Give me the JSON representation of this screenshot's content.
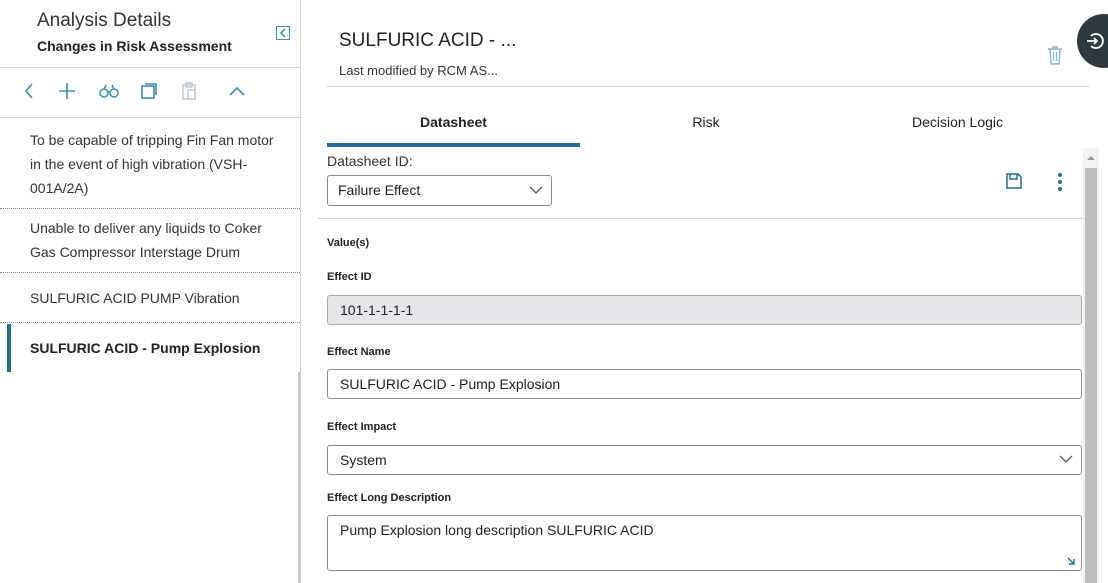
{
  "left_panel": {
    "title": "Analysis Details",
    "subtitle": "Changes in Risk Assessment",
    "toolbar_icons": [
      "back-icon",
      "add-icon",
      "binoculars-icon",
      "copy-icon",
      "paste-icon",
      "chevron-up-icon"
    ],
    "items": [
      {
        "label": "To be capable of tripping Fin Fan motor in the event of high vibration (VSH-001A/2A)",
        "selected": false
      },
      {
        "label": "Unable to deliver any liquids to Coker Gas Compressor Interstage Drum",
        "selected": false
      },
      {
        "label": "SULFURIC ACID PUMP Vibration",
        "selected": false
      },
      {
        "label": "SULFURIC ACID - Pump Explosion",
        "selected": true
      }
    ]
  },
  "header": {
    "title": "SULFURIC ACID - ...",
    "subtitle": "Last modified by RCM AS..."
  },
  "tabs": [
    {
      "label": "Datasheet",
      "active": true
    },
    {
      "label": "Risk",
      "active": false
    },
    {
      "label": "Decision Logic",
      "active": false
    }
  ],
  "datasheet": {
    "id_label": "Datasheet ID:",
    "id_value": "Failure Effect",
    "values_heading": "Value(s)",
    "fields": {
      "effect_id": {
        "label": "Effect ID",
        "value": "101-1-1-1-1"
      },
      "effect_name": {
        "label": "Effect Name",
        "value": "SULFURIC ACID - Pump Explosion"
      },
      "effect_impact": {
        "label": "Effect Impact",
        "value": "System"
      },
      "effect_long_description": {
        "label": "Effect Long Description",
        "value": "Pump Explosion long description SULFURIC ACID"
      }
    }
  },
  "colors": {
    "accent": "#1f6f91",
    "fab": "#2f3a40",
    "readonly_field": "#e4e6ea"
  }
}
